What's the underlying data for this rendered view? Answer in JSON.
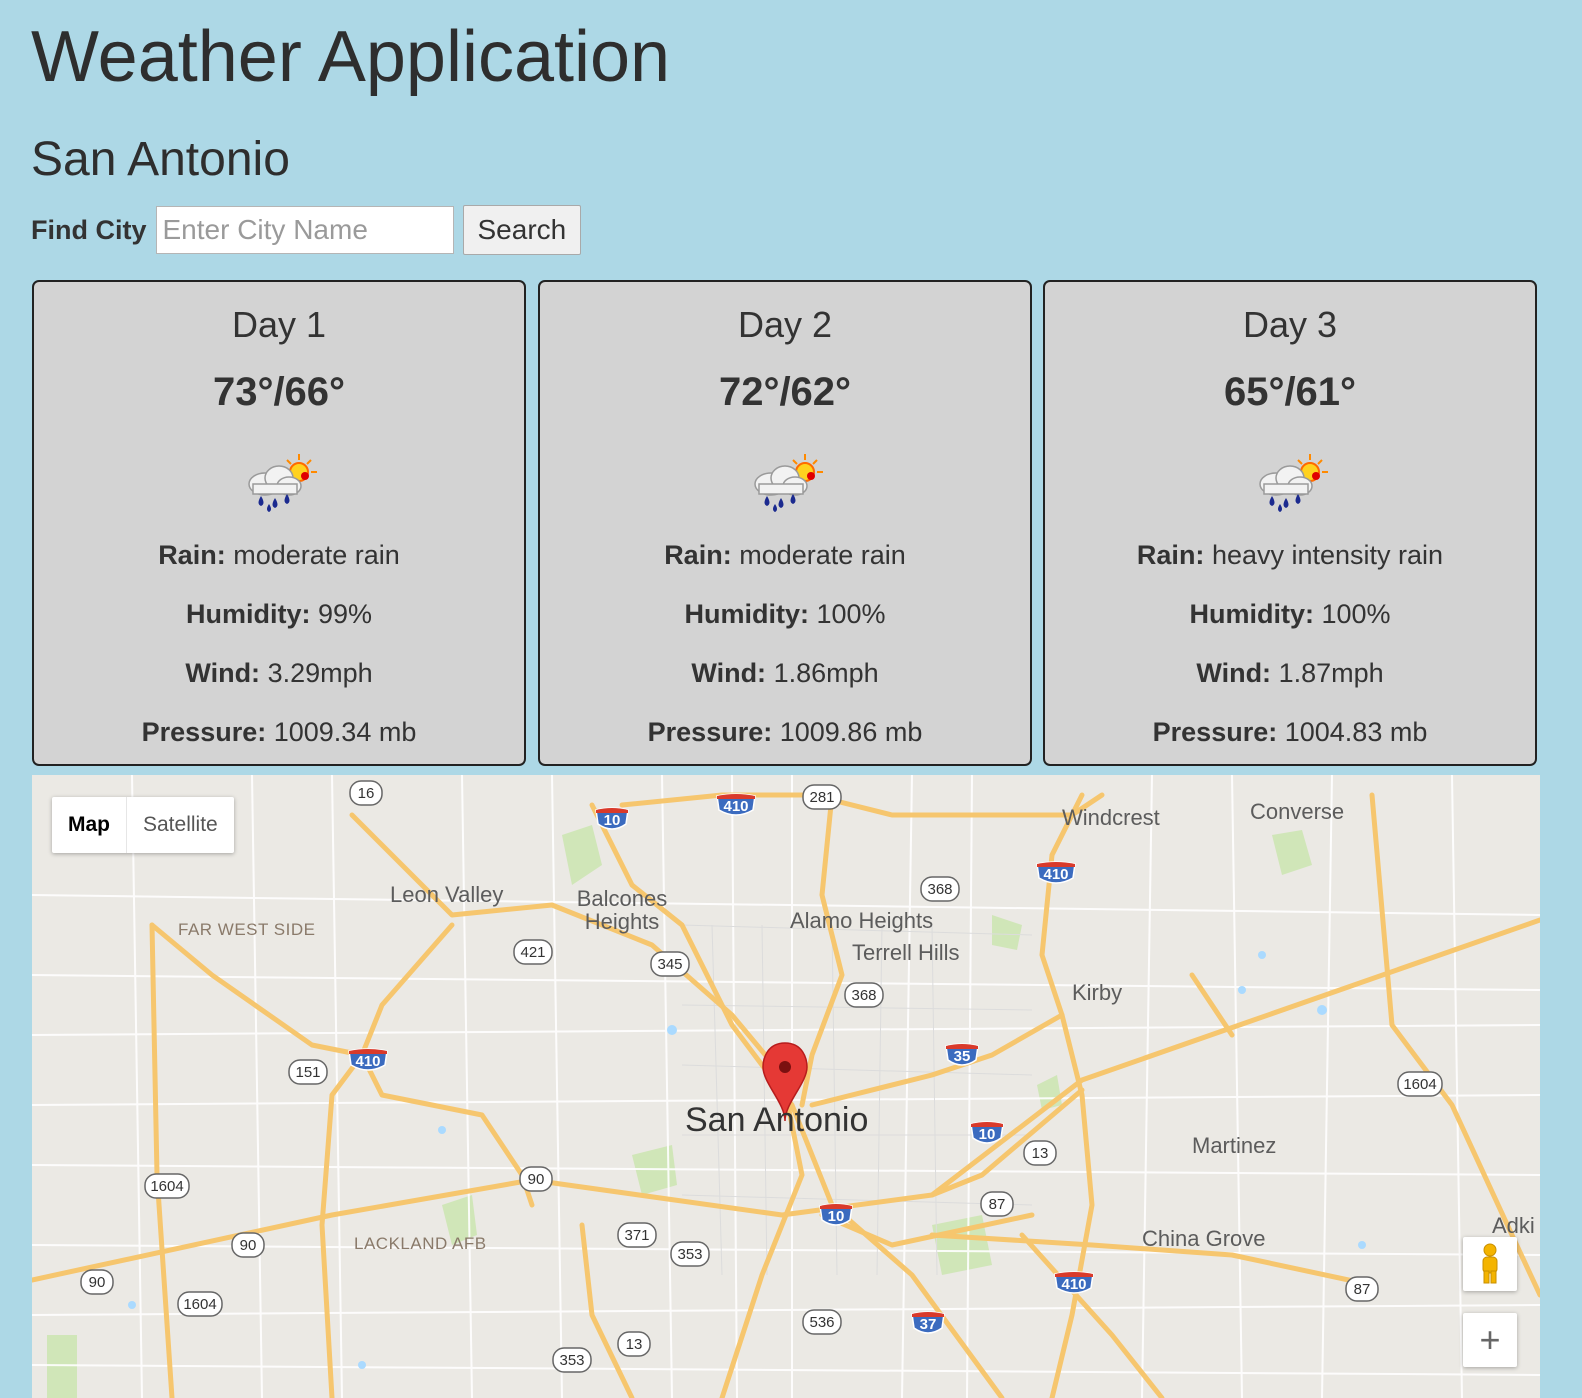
{
  "header": {
    "title": "Weather Application"
  },
  "location": {
    "city": "San Antonio"
  },
  "search": {
    "label": "Find City",
    "placeholder": "Enter City Name",
    "value": "",
    "button_label": "Search"
  },
  "forecast": [
    {
      "day": "Day 1",
      "temps": "73°/66°",
      "icon": "rain-sun-icon",
      "rain_label": "Rain:",
      "rain": "moderate rain",
      "humidity_label": "Humidity:",
      "humidity": "99%",
      "wind_label": "Wind:",
      "wind": "3.29mph",
      "pressure_label": "Pressure:",
      "pressure": "1009.34 mb"
    },
    {
      "day": "Day 2",
      "temps": "72°/62°",
      "icon": "rain-sun-icon",
      "rain_label": "Rain:",
      "rain": "moderate rain",
      "humidity_label": "Humidity:",
      "humidity": "100%",
      "wind_label": "Wind:",
      "wind": "1.86mph",
      "pressure_label": "Pressure:",
      "pressure": "1009.86 mb"
    },
    {
      "day": "Day 3",
      "temps": "65°/61°",
      "icon": "rain-sun-icon",
      "rain_label": "Rain:",
      "rain": "heavy intensity rain",
      "humidity_label": "Humidity:",
      "humidity": "100%",
      "wind_label": "Wind:",
      "wind": "1.87mph",
      "pressure_label": "Pressure:",
      "pressure": "1004.83 mb"
    }
  ],
  "map": {
    "type_options": [
      "Map",
      "Satellite"
    ],
    "selected_type": "Map",
    "center_label": "San Antonio",
    "places": [
      "Windcrest",
      "Converse",
      "Leon Valley",
      "Balcones Heights",
      "FAR WEST SIDE",
      "Alamo Heights",
      "Terrell Hills",
      "Kirby",
      "Martinez",
      "China Grove",
      "LACKLAND AFB",
      "Adki"
    ],
    "route_shields": [
      "16",
      "10",
      "410",
      "281",
      "410",
      "368",
      "421",
      "345",
      "368",
      "410",
      "151",
      "35",
      "1604",
      "10",
      "13",
      "90",
      "1604",
      "87",
      "10",
      "371",
      "90",
      "353",
      "90",
      "1604",
      "410",
      "87",
      "536",
      "37",
      "13",
      "353"
    ],
    "controls": {
      "pegman": "pegman-icon",
      "zoom_in": "+"
    },
    "colors": {
      "background": "#ebe9e4",
      "highway": "#f6c66e",
      "interstate": "#3b6bbf",
      "marker": "#e53935"
    }
  }
}
